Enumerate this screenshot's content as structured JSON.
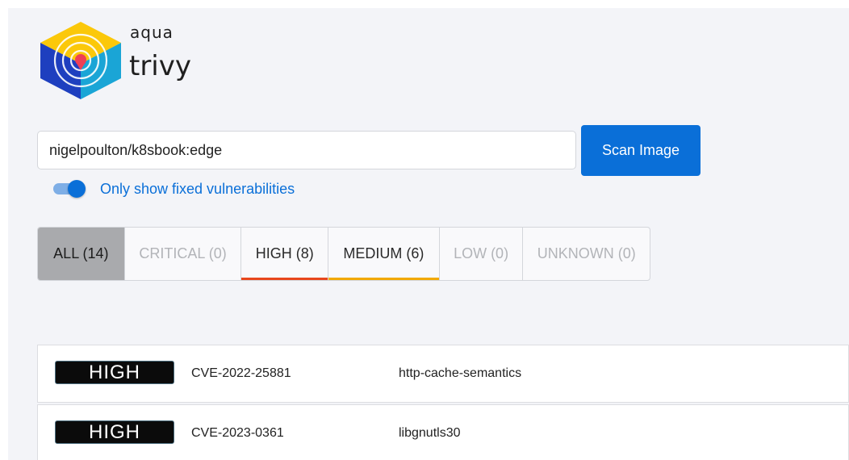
{
  "logo": {
    "brand": "aqua",
    "product": "trivy"
  },
  "search": {
    "value": "nigelpoulton/k8sbook:edge"
  },
  "scan_button": "Scan Image",
  "toggle": {
    "label": "Only show fixed vulnerabilities",
    "on": true
  },
  "tabs": [
    {
      "label": "ALL (14)",
      "state": "active"
    },
    {
      "label": "CRITICAL (0)",
      "state": "disabled"
    },
    {
      "label": "HIGH (8)",
      "state": "normal",
      "accent": "#e8471c"
    },
    {
      "label": "MEDIUM (6)",
      "state": "normal",
      "accent": "#f2a900"
    },
    {
      "label": "LOW (0)",
      "state": "disabled"
    },
    {
      "label": "UNKNOWN (0)",
      "state": "disabled"
    }
  ],
  "vulnerabilities": [
    {
      "severity": "HIGH",
      "id": "CVE-2022-25881",
      "package": "http-cache-semantics"
    },
    {
      "severity": "HIGH",
      "id": "CVE-2023-0361",
      "package": "libgnutls30"
    }
  ],
  "colors": {
    "primary": "#0a6fd8",
    "high": "#e8471c",
    "medium": "#f2a900"
  }
}
